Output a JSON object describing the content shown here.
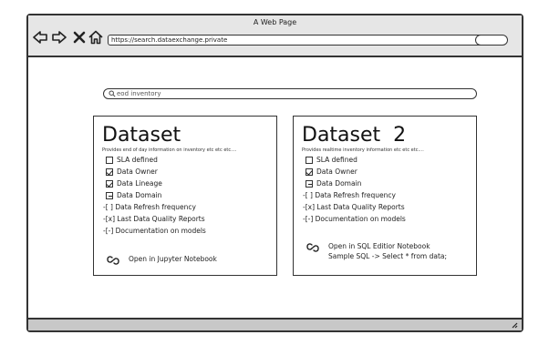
{
  "window": {
    "title": "A Web Page"
  },
  "browser": {
    "url": "https://search.dataexchange.private",
    "back_icon": "back-arrow-icon",
    "forward_icon": "forward-arrow-icon",
    "stop_icon": "close-icon",
    "home_icon": "home-icon"
  },
  "search": {
    "value": "eod inventory",
    "icon": "search-icon"
  },
  "cards": [
    {
      "title": "Dataset",
      "description": "Provides end of day information on inventory etc etc etc....",
      "checklist": [
        {
          "label": "SLA defined",
          "state": "unchecked"
        },
        {
          "label": "Data Owner",
          "state": "checked"
        },
        {
          "label": "Data Lineage",
          "state": "checked"
        },
        {
          "label": "Data Domain",
          "state": "indeterminate"
        }
      ],
      "text_items": [
        "-[ ] Data Refresh frequency",
        "-[x] Last Data Quality Reports",
        "-[-] Documentation on models"
      ],
      "link": {
        "icon": "link-icon",
        "line1": "Open in Jupyter Notebook",
        "line2": ""
      }
    },
    {
      "title": "Dataset  2",
      "description": "Provides realtime inventory information etc etc etc....",
      "checklist": [
        {
          "label": "SLA defined",
          "state": "unchecked"
        },
        {
          "label": "Data Owner",
          "state": "checked"
        },
        {
          "label": "Data Domain",
          "state": "indeterminate"
        }
      ],
      "text_items": [
        "-[ ] Data Refresh frequency",
        "-[x] Last Data Quality Reports",
        "-[-] Documentation on models"
      ],
      "link": {
        "icon": "link-icon",
        "line1": "Open in SQL Editior Notebook",
        "line2": "Sample SQL -> Select * from data;"
      }
    }
  ],
  "statusbar": {
    "grip_icon": "resize-grip-icon"
  }
}
